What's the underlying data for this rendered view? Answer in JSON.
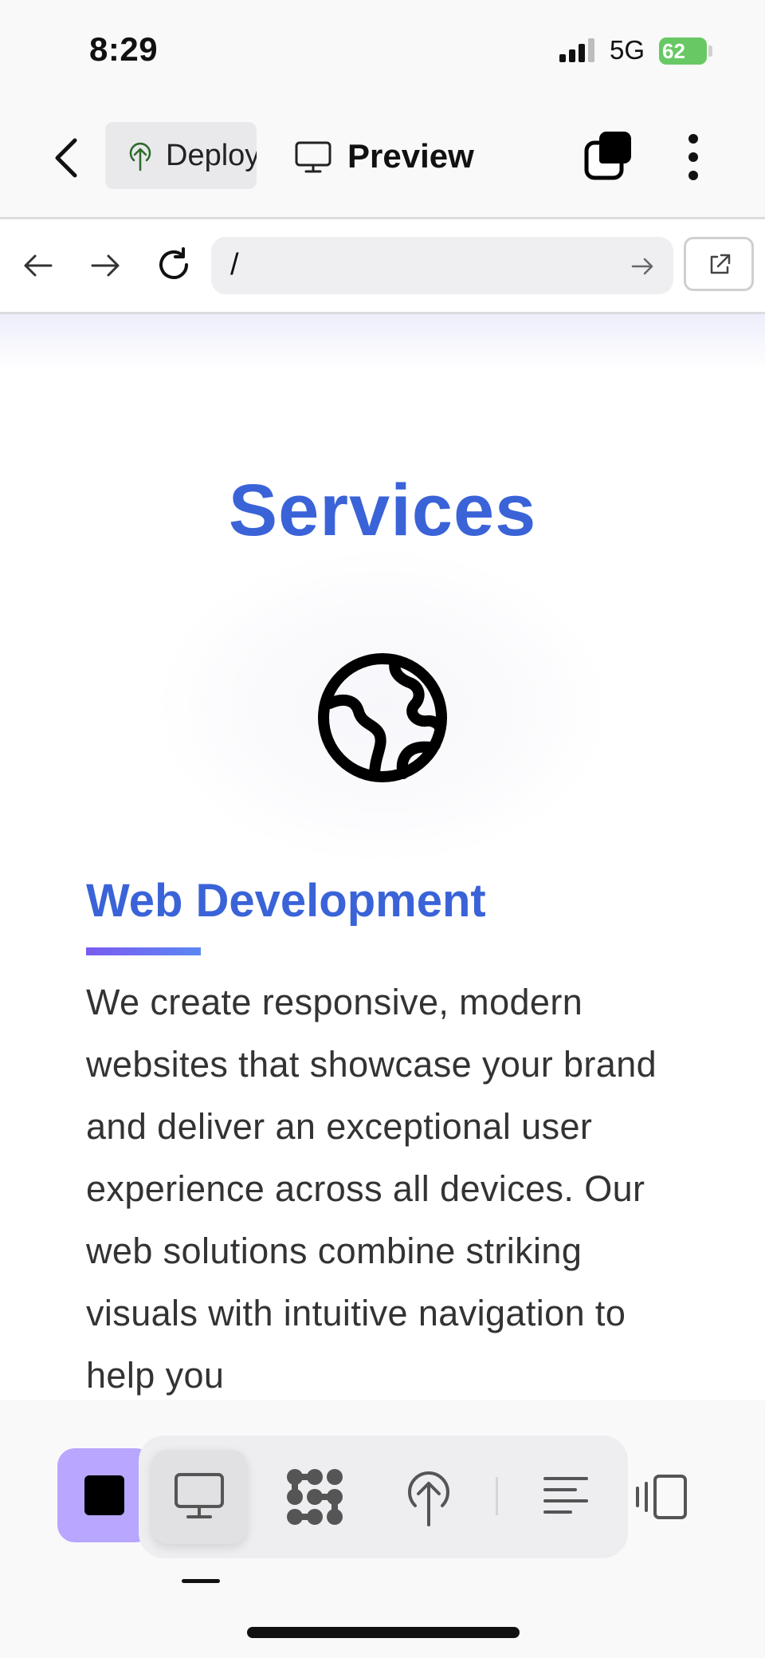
{
  "status_bar": {
    "time": "8:29",
    "network": "5G",
    "battery": "62"
  },
  "app_bar": {
    "deploy_label": "Deploy",
    "preview_label": "Preview"
  },
  "url_bar": {
    "url": "/"
  },
  "page": {
    "section_title": "Services",
    "card_title": "Web Development",
    "card_body": "We create responsive, modern websites that showcase your brand and deliver an exceptional user experience across all devices. Our web solutions combine striking visuals with intuitive navigation to help you"
  },
  "colors": {
    "accent_blue": "#3a63d8",
    "stop_button": "#b9a6ff",
    "battery_green": "#68c964",
    "deploy_green": "#2f6b2b"
  },
  "icons": {
    "back": "chevron-left-icon",
    "deploy": "tree-upload-icon",
    "preview": "monitor-icon",
    "tabs": "stacked-squares-icon",
    "more": "vertical-dots-icon",
    "nav_back": "arrow-left-icon",
    "nav_forward": "arrow-right-icon",
    "reload": "reload-icon",
    "go": "arrow-right-icon",
    "open_external": "external-link-icon",
    "service": "globe-icon",
    "toolbar": [
      "stop-icon",
      "monitor-icon",
      "pattern-icon",
      "tree-upload-icon",
      "align-left-icon",
      "device-preview-icon"
    ]
  }
}
